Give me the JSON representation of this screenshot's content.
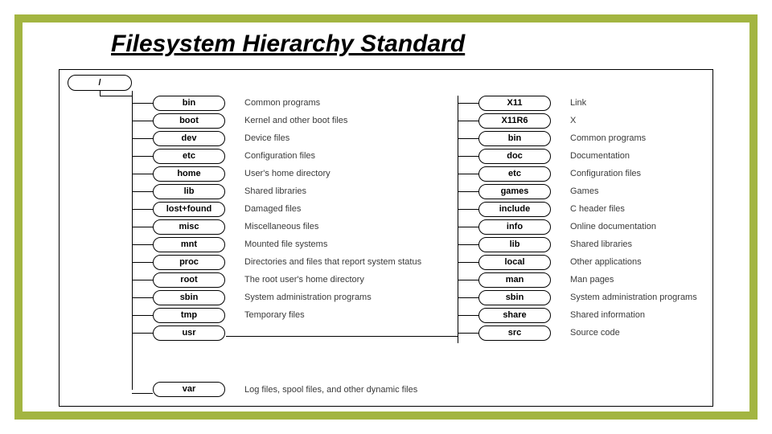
{
  "title": "Filesystem Hierarchy Standard",
  "root": "/",
  "left_entries": [
    {
      "name": "bin",
      "desc": "Common programs"
    },
    {
      "name": "boot",
      "desc": "Kernel and other boot files"
    },
    {
      "name": "dev",
      "desc": "Device files"
    },
    {
      "name": "etc",
      "desc": "Configuration files"
    },
    {
      "name": "home",
      "desc": "User's home directory"
    },
    {
      "name": "lib",
      "desc": "Shared libraries"
    },
    {
      "name": "lost+found",
      "desc": "Damaged files"
    },
    {
      "name": "misc",
      "desc": "Miscellaneous files"
    },
    {
      "name": "mnt",
      "desc": "Mounted file systems"
    },
    {
      "name": "proc",
      "desc": "Directories and files that report system status"
    },
    {
      "name": "root",
      "desc": "The root user's home directory"
    },
    {
      "name": "sbin",
      "desc": "System administration programs"
    },
    {
      "name": "tmp",
      "desc": "Temporary files"
    },
    {
      "name": "usr",
      "desc": ""
    }
  ],
  "right_entries": [
    {
      "name": "X11",
      "desc": "Link"
    },
    {
      "name": "X11R6",
      "desc": "X"
    },
    {
      "name": "bin",
      "desc": "Common programs"
    },
    {
      "name": "doc",
      "desc": "Documentation"
    },
    {
      "name": "etc",
      "desc": "Configuration files"
    },
    {
      "name": "games",
      "desc": "Games"
    },
    {
      "name": "include",
      "desc": "C header files"
    },
    {
      "name": "info",
      "desc": "Online documentation"
    },
    {
      "name": "lib",
      "desc": "Shared libraries"
    },
    {
      "name": "local",
      "desc": "Other applications"
    },
    {
      "name": "man",
      "desc": "Man pages"
    },
    {
      "name": "sbin",
      "desc": "System administration programs"
    },
    {
      "name": "share",
      "desc": "Shared information"
    },
    {
      "name": "src",
      "desc": "Source code"
    }
  ],
  "var_entry": {
    "name": "var",
    "desc": "Log files, spool files, and other dynamic files"
  }
}
